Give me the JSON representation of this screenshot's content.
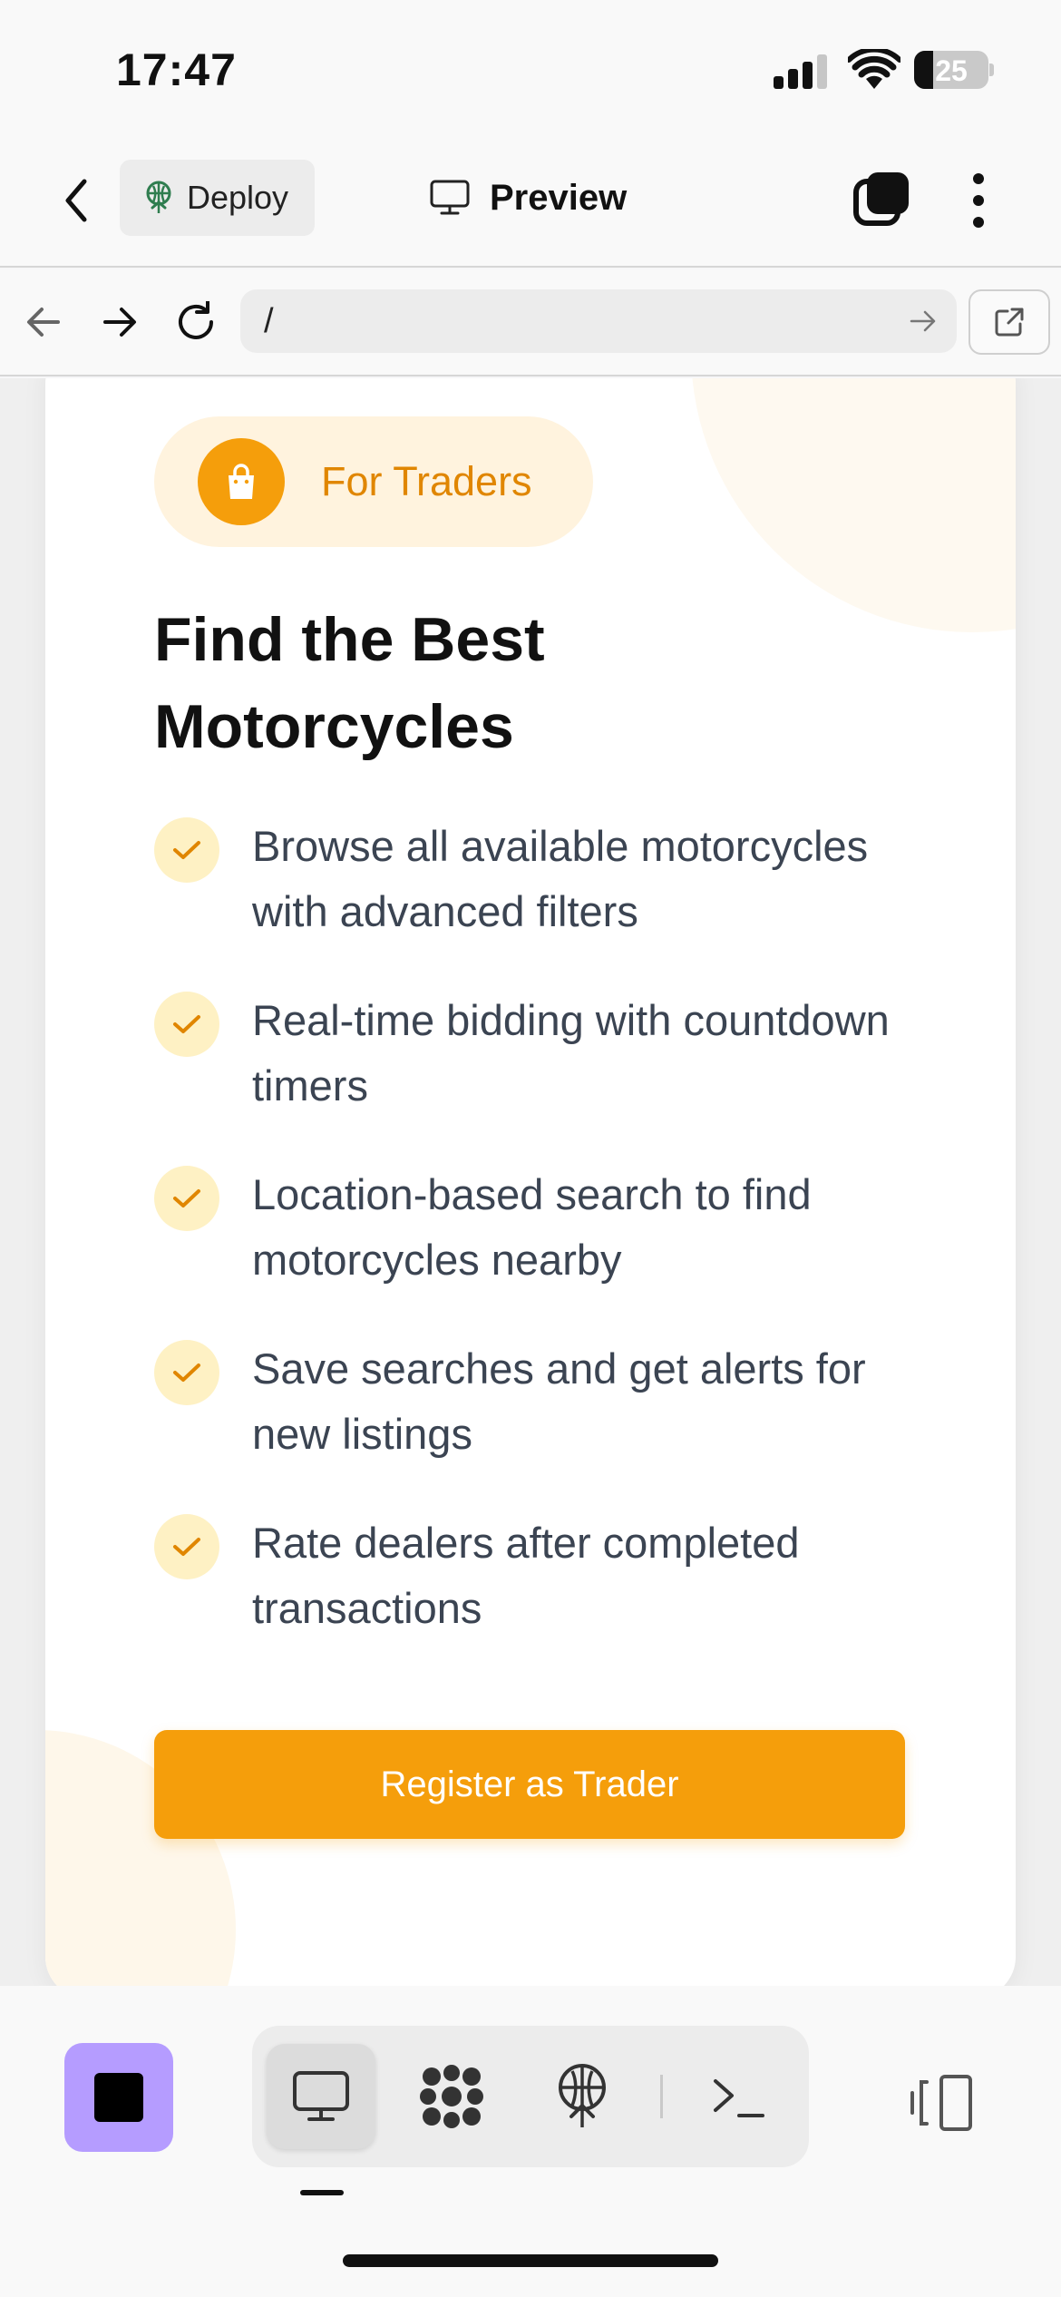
{
  "status_bar": {
    "time": "17:47",
    "battery": "25",
    "battery_level": 0.25
  },
  "header": {
    "back_icon": "chevron-left-icon",
    "deploy_label": "Deploy",
    "deploy_icon": "deploy-tree-icon",
    "preview_label": "Preview",
    "preview_icon": "monitor-icon",
    "tabs_icon": "tabs-icon",
    "more_icon": "more-vertical-icon"
  },
  "browser": {
    "url": "/",
    "back_icon": "arrow-left-icon",
    "forward_icon": "arrow-right-icon",
    "reload_icon": "reload-icon",
    "go_icon": "arrow-right-icon",
    "external_icon": "external-link-icon"
  },
  "card": {
    "badge_label": "For Traders",
    "badge_icon": "shopping-bag-icon",
    "title": "Find the Best Motorcycles",
    "features": [
      "Browse all available motorcycles with advanced filters",
      "Real-time bidding with countdown timers",
      "Location-based search to find motorcycles nearby",
      "Save searches and get alerts for new listings",
      "Rate dealers after completed transactions"
    ],
    "cta_label": "Register as Trader"
  },
  "toolbar": {
    "stop_icon": "stop-icon",
    "tools": [
      "monitor-icon",
      "grid-flower-icon",
      "deploy-icon",
      "terminal-icon"
    ],
    "panel_icon": "panel-toggle-icon"
  },
  "colors": {
    "accent": "#f59e0b",
    "accent_light": "#fff3de",
    "check_bg": "#fef1c4",
    "stop_bg": "#b59cff",
    "text_muted": "#3b4452"
  }
}
